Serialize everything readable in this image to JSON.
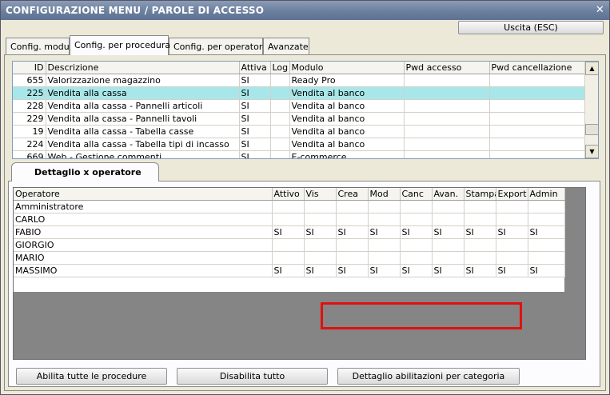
{
  "window": {
    "title": "CONFIGURAZIONE MENU / PAROLE DI ACCESSO",
    "close_glyph": "✕"
  },
  "toolbar": {
    "exit_label": "Uscita (ESC)"
  },
  "tabs": [
    {
      "label": "Config. moduli",
      "active": false
    },
    {
      "label": "Config. per procedura",
      "active": true
    },
    {
      "label": "Config. per operatore",
      "active": false
    },
    {
      "label": "Avanzate",
      "active": false
    }
  ],
  "procedures": {
    "columns": [
      "ID",
      "Descrizione",
      "Attiva",
      "Log",
      "Modulo",
      "Pwd accesso",
      "Pwd cancellazione"
    ],
    "rows": [
      {
        "id": "655",
        "desc": "Valorizzazione magazzino",
        "attiva": "SI",
        "log": "",
        "modulo": "Ready Pro",
        "pwd": "",
        "pwdc": "",
        "selected": false
      },
      {
        "id": "225",
        "desc": "Vendita alla cassa",
        "attiva": "SI",
        "log": "",
        "modulo": "Vendita al banco",
        "pwd": "",
        "pwdc": "",
        "selected": true
      },
      {
        "id": "228",
        "desc": "Vendita alla cassa - Pannelli articoli",
        "attiva": "SI",
        "log": "",
        "modulo": "Vendita al banco",
        "pwd": "",
        "pwdc": "",
        "selected": false
      },
      {
        "id": "229",
        "desc": "Vendita alla cassa - Pannelli tavoli",
        "attiva": "SI",
        "log": "",
        "modulo": "Vendita al banco",
        "pwd": "",
        "pwdc": "",
        "selected": false
      },
      {
        "id": "19",
        "desc": "Vendita alla cassa - Tabella casse",
        "attiva": "SI",
        "log": "",
        "modulo": "Vendita al banco",
        "pwd": "",
        "pwdc": "",
        "selected": false
      },
      {
        "id": "224",
        "desc": "Vendita alla cassa - Tabella tipi di incasso",
        "attiva": "SI",
        "log": "",
        "modulo": "Vendita al banco",
        "pwd": "",
        "pwdc": "",
        "selected": false
      },
      {
        "id": "669",
        "desc": "Web - Gestione commenti",
        "attiva": "SI",
        "log": "",
        "modulo": "E-commerce",
        "pwd": "",
        "pwdc": "",
        "selected": false
      }
    ],
    "scroll_up": "▲",
    "scroll_down": "▼"
  },
  "detail": {
    "tab_label": "Dettaglio x operatore",
    "columns": [
      "Operatore",
      "Attivo",
      "Vis",
      "Crea",
      "Mod",
      "Canc",
      "Avan.",
      "Stampa",
      "Export",
      "Admin"
    ],
    "rows": [
      [
        "Amministratore",
        "",
        "",
        "",
        "",
        "",
        "",
        "",
        "",
        ""
      ],
      [
        "CARLO",
        "",
        "",
        "",
        "",
        "",
        "",
        "",
        "",
        ""
      ],
      [
        "FABIO",
        "SI",
        "SI",
        "SI",
        "SI",
        "SI",
        "SI",
        "SI",
        "SI",
        "SI"
      ],
      [
        "GIORGIO",
        "",
        "",
        "",
        "",
        "",
        "",
        "",
        "",
        ""
      ],
      [
        "MARIO",
        "",
        "",
        "",
        "",
        "",
        "",
        "",
        "",
        ""
      ],
      [
        "MASSIMO",
        "SI",
        "SI",
        "SI",
        "SI",
        "SI",
        "SI",
        "SI",
        "SI",
        "SI"
      ]
    ]
  },
  "footer": {
    "enable_all": "Abilita tutte le procedure",
    "disable_all": "Disabilita tutto",
    "category_detail": "Dettaglio abilitazioni per categoria"
  },
  "colors": {
    "selected_row": "#a7e7ea",
    "highlight_box": "#e0100e",
    "titlebar": "#6b7f9e"
  }
}
